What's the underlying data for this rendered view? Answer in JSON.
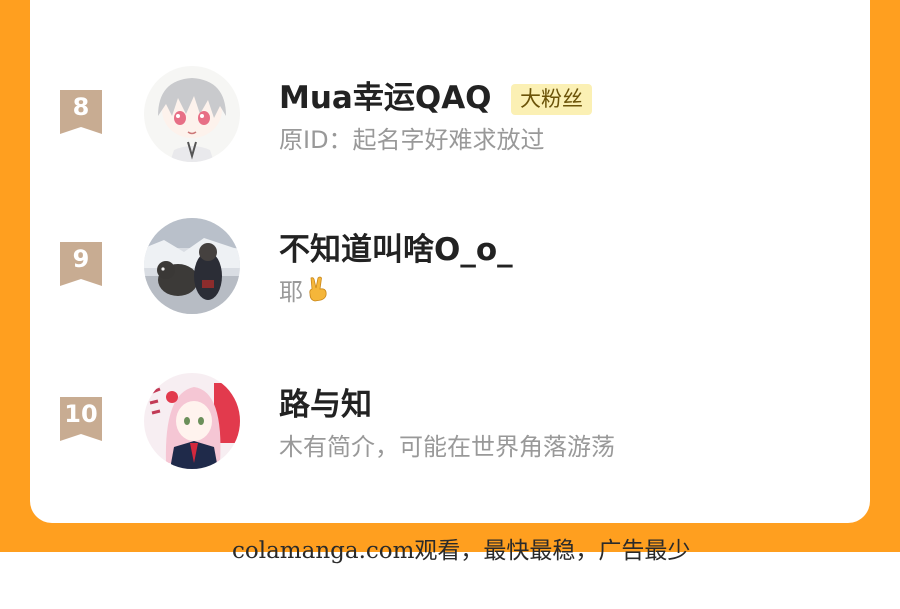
{
  "rankings": [
    {
      "rank": "8",
      "name": "Mua幸运QAQ",
      "badge": "大粉丝",
      "bio": "原ID：起名字好难求放过",
      "avatar_icon": "avatar-white-haired-anime-boy"
    },
    {
      "rank": "9",
      "name": "不知道叫啥O_o_",
      "bio": "耶",
      "bio_emoji": "victory-hand",
      "avatar_icon": "avatar-snowy-photo-with-dog"
    },
    {
      "rank": "10",
      "name": "路与知",
      "bio": "木有简介，可能在世界角落游荡",
      "avatar_icon": "avatar-pink-haired-anime-girl"
    }
  ],
  "footer_text": "colamanga.com观看，最快最稳，广告最少",
  "colors": {
    "frame": "#ff9f1f",
    "card": "#ffffff",
    "rank_ribbon": "#c8ac92",
    "badge_bg": "#fbf0b4",
    "name_text": "#222222",
    "bio_text": "#999999"
  }
}
